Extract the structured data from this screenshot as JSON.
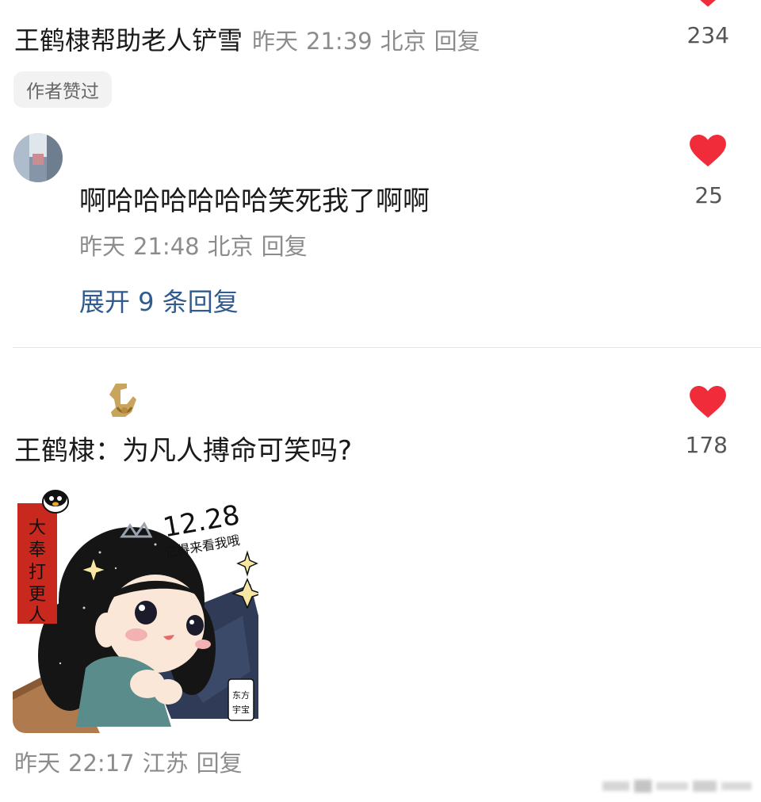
{
  "colors": {
    "like_red": "#f02b3a",
    "meta_gray": "#8c8c8c",
    "link_blue": "#2f5b8f",
    "text_dark": "#1a1a1a"
  },
  "top_comment": {
    "cut_username": "",
    "text": "王鹤棣帮助老人铲雪",
    "date": "昨天",
    "time": "21:39",
    "location": "北京",
    "reply_label": "回复",
    "like_count": "234",
    "author_liked_tag": "作者赞过"
  },
  "reply": {
    "username_blurred": "",
    "text": "啊哈哈哈哈哈哈笑死我了啊啊",
    "date": "昨天",
    "time": "21:48",
    "location": "北京",
    "reply_label": "回复",
    "like_count": "25",
    "expand_label": "展开 9 条回复"
  },
  "second_comment": {
    "username_blurred": "",
    "text": "王鹤棣：为凡人搏命可笑吗?",
    "like_count": "178",
    "date": "昨天",
    "time": "22:17",
    "location": "江苏",
    "reply_label": "回复",
    "sticker": {
      "banner_text": "大奉打更人",
      "date_text": "12.28",
      "handwritten_text": "记得来看我哦",
      "seal_text": "东方宇宝"
    }
  },
  "icons": {
    "like": "heart-icon",
    "badge": "user-badge-icon"
  }
}
